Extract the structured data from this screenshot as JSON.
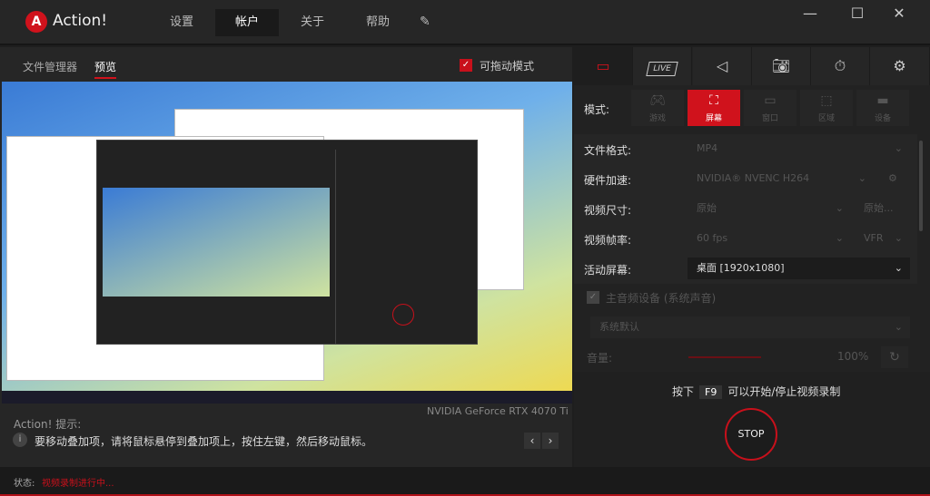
{
  "app": {
    "title": "Action!",
    "logo_letter": "A"
  },
  "nav": [
    {
      "label": "设置"
    },
    {
      "label": "帐户",
      "active": true
    },
    {
      "label": "关于"
    },
    {
      "label": "帮助"
    }
  ],
  "window_controls": {
    "minimize": "—",
    "maximize": "☐",
    "close": "✕"
  },
  "left": {
    "tabs": [
      {
        "label": "文件管理器"
      },
      {
        "label": "预览",
        "active": true
      }
    ],
    "draggable_mode": {
      "label": "可拖动模式",
      "checked": true
    }
  },
  "gpu": "NVIDIA GeForce RTX 4070 Ti",
  "hint": {
    "title": "Action! 提示:",
    "text": "要移动叠加项，请将鼠标悬停到叠加项上，按住左键，然后移动鼠标。"
  },
  "status": {
    "label": "状态:",
    "value": "视频录制进行中..."
  },
  "right": {
    "tabs": [
      "video-record",
      "live-stream",
      "audio",
      "screenshot",
      "timer",
      "settings"
    ],
    "tab_live_label": "LIVE",
    "mode_label": "模式:",
    "modes": [
      {
        "label": "游戏"
      },
      {
        "label": "屏幕",
        "active": true
      },
      {
        "label": "窗口"
      },
      {
        "label": "区域"
      },
      {
        "label": "设备"
      }
    ],
    "settings": [
      {
        "label": "文件格式:",
        "value": "MP4"
      },
      {
        "label": "硬件加速:",
        "value": "NVIDIA® NVENC H264"
      },
      {
        "label": "视频尺寸:",
        "value": "原始",
        "value2": "原始..."
      },
      {
        "label": "视频帧率:",
        "value": "60 fps",
        "value2": "VFR"
      },
      {
        "label": "活动屏幕:",
        "value": "桌面 [1920x1080]"
      }
    ],
    "audio": {
      "label": "主音频设备 (系统声音)",
      "checked": true,
      "device": "系统默认",
      "volume_label": "音量:",
      "volume": "100%"
    },
    "f9": {
      "pre": "按下",
      "key": "F9",
      "post": "可以开始/停止视频录制"
    },
    "stop": "STOP"
  },
  "colors": {
    "accent": "#d0121c",
    "bg": "#222222"
  }
}
